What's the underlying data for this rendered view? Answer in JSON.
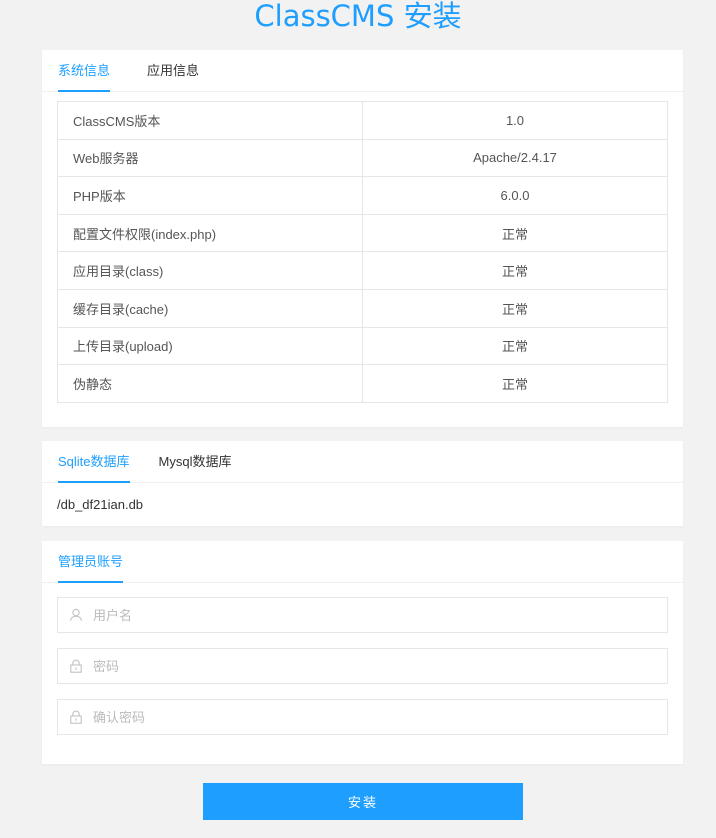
{
  "page": {
    "title": "ClassCMS 安装"
  },
  "info_card": {
    "tabs": [
      {
        "label": "系统信息",
        "active": true
      },
      {
        "label": "应用信息",
        "active": false
      }
    ],
    "rows": [
      {
        "key": "ClassCMS版本",
        "value": "1.0"
      },
      {
        "key": "Web服务器",
        "value": "Apache/2.4.17"
      },
      {
        "key": "PHP版本",
        "value": "6.0.0"
      },
      {
        "key": "配置文件权限(index.php)",
        "value": "正常"
      },
      {
        "key": "应用目录(class)",
        "value": "正常"
      },
      {
        "key": "缓存目录(cache)",
        "value": "正常"
      },
      {
        "key": "上传目录(upload)",
        "value": "正常"
      },
      {
        "key": "伪静态",
        "value": "正常"
      }
    ]
  },
  "db_card": {
    "tabs": [
      {
        "label": "Sqlite数据库",
        "active": true
      },
      {
        "label": "Mysql数据库",
        "active": false
      }
    ],
    "path": "/db_df21ian.db"
  },
  "admin_card": {
    "tabs": [
      {
        "label": "管理员账号",
        "active": true
      }
    ],
    "username": {
      "placeholder": "用户名",
      "icon": "user-icon",
      "value": ""
    },
    "password": {
      "placeholder": "密码",
      "icon": "lock-icon",
      "value": ""
    },
    "confirm_password": {
      "placeholder": "确认密码",
      "icon": "lock-icon",
      "value": ""
    }
  },
  "install_button": {
    "label": "安装"
  },
  "colors": {
    "accent": "#1e9fff",
    "background": "#f2f2f2",
    "border": "#e6e6e6",
    "icon": "#c2c2c2"
  }
}
